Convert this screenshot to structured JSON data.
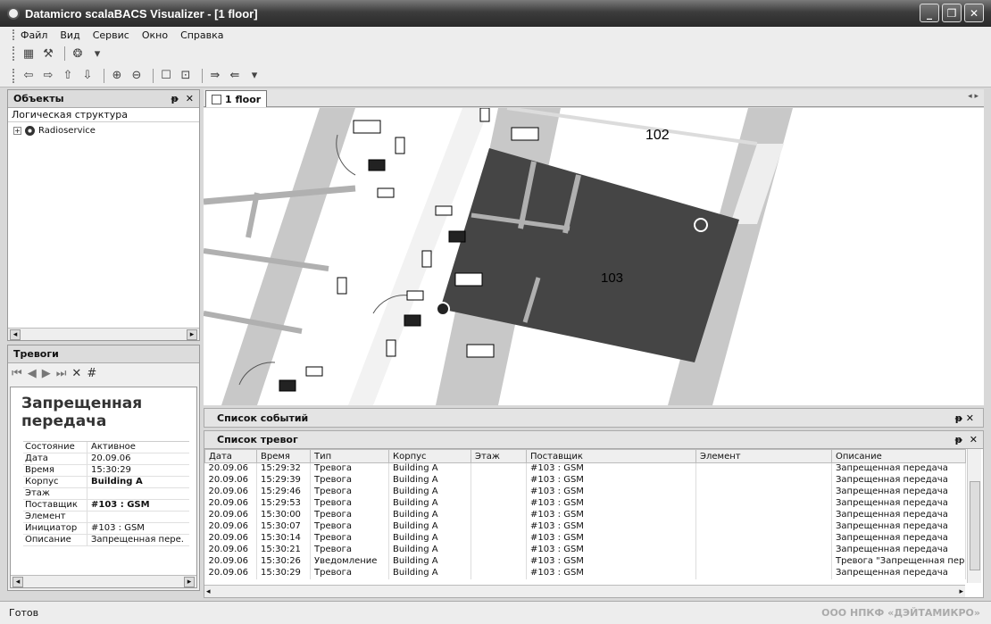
{
  "window": {
    "title": "Datamicro scalaBACS Visualizer - [1 floor]",
    "minimize": "_",
    "restore": "❐",
    "close": "✕"
  },
  "menu": [
    "Файл",
    "Вид",
    "Сервис",
    "Окно",
    "Справка"
  ],
  "objects_panel": {
    "title": "Объекты",
    "pin": "ᵽ",
    "close": "✕",
    "subtitle": "Логическая структура",
    "tree": [
      {
        "toggle": "+",
        "label": "Radioservice"
      }
    ]
  },
  "alarms_panel": {
    "title": "Тревоги",
    "current_alarm": {
      "title": "Запрещенная передача",
      "props": [
        {
          "key": "Состояние",
          "value": "Активное",
          "bold": false
        },
        {
          "key": "Дата",
          "value": "20.09.06",
          "bold": false
        },
        {
          "key": "Время",
          "value": "15:30:29",
          "bold": false
        },
        {
          "key": "Корпус",
          "value": "Building A",
          "bold": true
        },
        {
          "key": "Этаж",
          "value": "",
          "bold": false
        },
        {
          "key": "Поставщик",
          "value": "#103 : GSM",
          "bold": true
        },
        {
          "key": "Элемент",
          "value": "",
          "bold": false
        },
        {
          "key": "Инициатор",
          "value": "#103 : GSM",
          "bold": false
        },
        {
          "key": "Описание",
          "value": "Запрещенная пере.",
          "bold": false
        }
      ]
    }
  },
  "document": {
    "tab": "1 floor",
    "room_labels": [
      "102",
      "103"
    ]
  },
  "events_list": {
    "title": "Список событий"
  },
  "alarms_list": {
    "title": "Список тревог",
    "columns": [
      "Дата",
      "Время",
      "Тип",
      "Корпус",
      "Этаж",
      "Поставщик",
      "Элемент",
      "Описание"
    ],
    "rows": [
      [
        "20.09.06",
        "15:29:32",
        "Тревога",
        "Building A",
        "",
        "#103 : GSM",
        "",
        "Запрещенная передача"
      ],
      [
        "20.09.06",
        "15:29:39",
        "Тревога",
        "Building A",
        "",
        "#103 : GSM",
        "",
        "Запрещенная передача"
      ],
      [
        "20.09.06",
        "15:29:46",
        "Тревога",
        "Building A",
        "",
        "#103 : GSM",
        "",
        "Запрещенная передача"
      ],
      [
        "20.09.06",
        "15:29:53",
        "Тревога",
        "Building A",
        "",
        "#103 : GSM",
        "",
        "Запрещенная передача"
      ],
      [
        "20.09.06",
        "15:30:00",
        "Тревога",
        "Building A",
        "",
        "#103 : GSM",
        "",
        "Запрещенная передача"
      ],
      [
        "20.09.06",
        "15:30:07",
        "Тревога",
        "Building A",
        "",
        "#103 : GSM",
        "",
        "Запрещенная передача"
      ],
      [
        "20.09.06",
        "15:30:14",
        "Тревога",
        "Building A",
        "",
        "#103 : GSM",
        "",
        "Запрещенная передача"
      ],
      [
        "20.09.06",
        "15:30:21",
        "Тревога",
        "Building A",
        "",
        "#103 : GSM",
        "",
        "Запрещенная передача"
      ],
      [
        "20.09.06",
        "15:30:26",
        "Уведомление",
        "Building A",
        "",
        "#103 : GSM",
        "",
        "Тревога \"Запрещенная пере."
      ],
      [
        "20.09.06",
        "15:30:29",
        "Тревога",
        "Building A",
        "",
        "#103 : GSM",
        "",
        "Запрещенная передача"
      ]
    ]
  },
  "status": {
    "text": "Готов",
    "brand": "ООО НПКФ «ДЭЙТАМИКРО»"
  },
  "colors": {
    "room": "#454545",
    "corridor": "#c8c8c8",
    "wall": "#b0b0b0"
  }
}
